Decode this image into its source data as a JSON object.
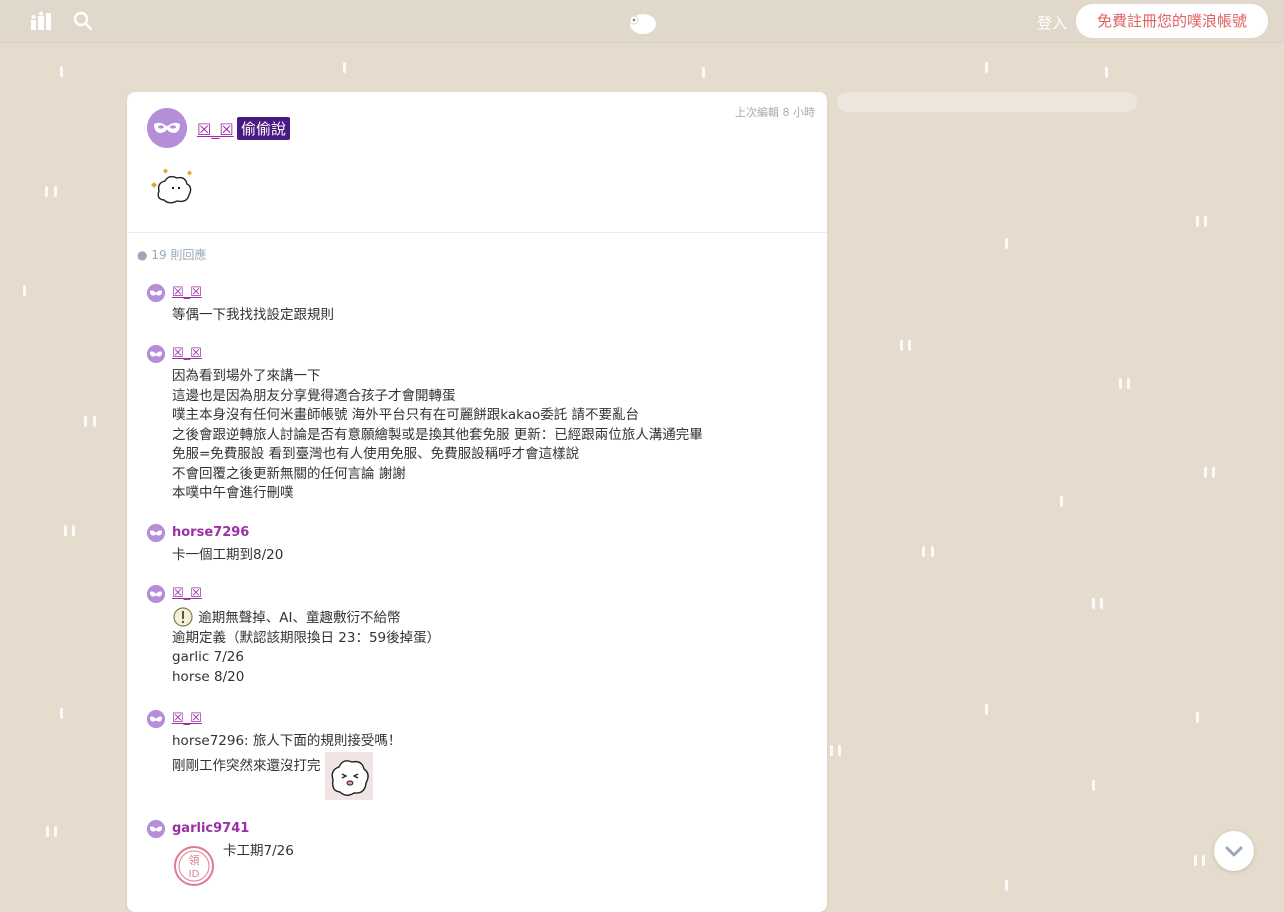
{
  "topbar": {
    "login_label": "登入",
    "signup_label": "免費註冊您的噗浪帳號"
  },
  "post": {
    "edited_label": "上次編輯 8 小時",
    "author": "☒_☒",
    "whisper_label": "偷偷說",
    "reply_count": "19 則回應"
  },
  "replies": [
    {
      "author": "☒_☒",
      "lines": [
        "等偶一下我找找設定跟規則"
      ]
    },
    {
      "author": "☒_☒",
      "lines": [
        "因為看到場外了來講一下",
        "這邊也是因為朋友分享覺得適合孩子才會開轉蛋",
        "噗主本身沒有任何米畫師帳號 海外平台只有在可麗餅跟kakao委託 請不要亂台",
        "之後會跟逆轉旅人討論是否有意願繪製或是換其他套免服 更新：已經跟兩位旅人溝通完畢",
        "免服=免費服設 看到臺灣也有人使用免服、免費服設稱呼才會這樣說",
        "不會回覆之後更新無關的任何言論 謝謝",
        "本噗中午會進行刪噗"
      ]
    },
    {
      "author": "horse7296",
      "lines": [
        "卡一個工期到8/20"
      ]
    },
    {
      "author": "☒_☒",
      "lines": [
        "逾期無聲掉、AI、童趣敷衍不給幣",
        "逾期定義（默認該期限換日 23：59後掉蛋）",
        "garlic 7/26",
        "horse 8/20"
      ]
    },
    {
      "author": "☒_☒",
      "lines": [
        "horse7296: 旅人下面的規則接受嗎！",
        "剛剛工作突然來還沒打完"
      ]
    },
    {
      "author": "garlic9741",
      "lines": [
        "卡工期7/26"
      ]
    }
  ],
  "colors": {
    "background": "#e6dccd",
    "accent": "#9c2fa6",
    "signup_text": "#e06262",
    "whisper_bg": "#4a1a82"
  }
}
